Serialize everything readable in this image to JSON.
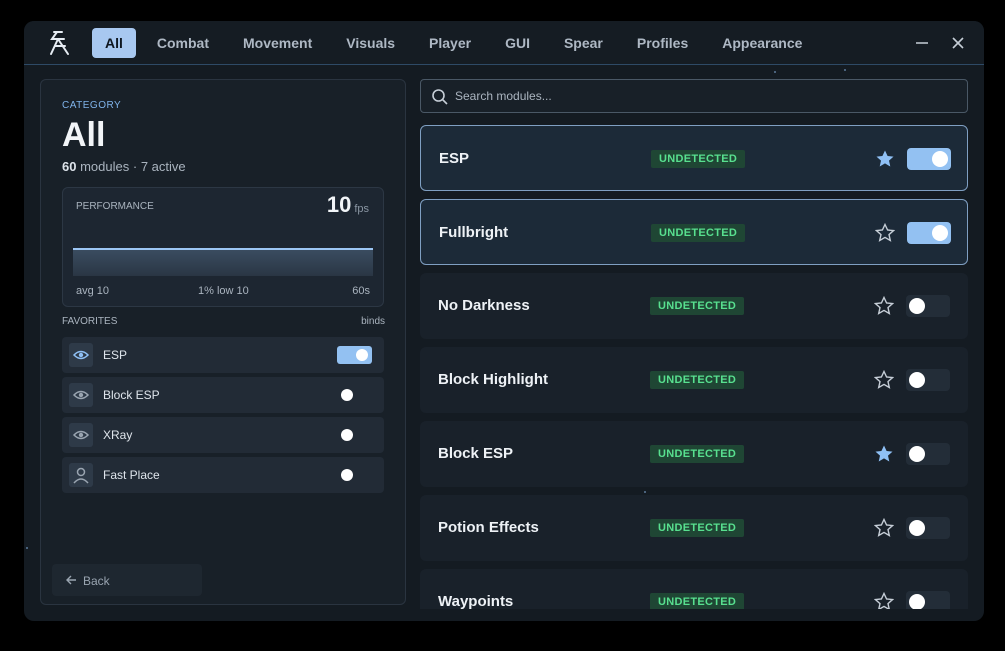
{
  "tabs": [
    {
      "label": "All",
      "active": true
    },
    {
      "label": "Combat"
    },
    {
      "label": "Movement"
    },
    {
      "label": "Visuals"
    },
    {
      "label": "Player"
    },
    {
      "label": "GUI"
    },
    {
      "label": "Spear"
    },
    {
      "label": "Profiles"
    },
    {
      "label": "Appearance"
    }
  ],
  "category": {
    "label": "CATEGORY",
    "title": "All",
    "module_count": "60",
    "modules_word": "modules",
    "active_count": "7",
    "active_word": "active"
  },
  "performance": {
    "label": "PERFORMANCE",
    "fps": "10",
    "fps_unit": "fps",
    "avg": "avg 10",
    "low": "1% low 10",
    "window": "60s"
  },
  "favorites": {
    "label": "FAVORITES",
    "binds_label": "binds",
    "items": [
      {
        "name": "ESP",
        "icon": "eye-icon",
        "enabled": true
      },
      {
        "name": "Block ESP",
        "icon": "eye-icon",
        "enabled": false
      },
      {
        "name": "XRay",
        "icon": "eye-icon",
        "enabled": false
      },
      {
        "name": "Fast Place",
        "icon": "user-icon",
        "enabled": false
      }
    ]
  },
  "back_label": "Back",
  "search": {
    "placeholder": "Search modules..."
  },
  "modules": [
    {
      "name": "ESP",
      "status": "UNDETECTED",
      "favorite": true,
      "enabled": true
    },
    {
      "name": "Fullbright",
      "status": "UNDETECTED",
      "favorite": false,
      "enabled": true
    },
    {
      "name": "No Darkness",
      "status": "UNDETECTED",
      "favorite": false,
      "enabled": false
    },
    {
      "name": "Block Highlight",
      "status": "UNDETECTED",
      "favorite": false,
      "enabled": false
    },
    {
      "name": "Block ESP",
      "status": "UNDETECTED",
      "favorite": true,
      "enabled": false
    },
    {
      "name": "Potion Effects",
      "status": "UNDETECTED",
      "favorite": false,
      "enabled": false
    },
    {
      "name": "Waypoints",
      "status": "UNDETECTED",
      "favorite": false,
      "enabled": false
    }
  ],
  "colors": {
    "accent": "#93c1f2",
    "badge_text": "#58e08f",
    "badge_bg": "#1f4634",
    "star_filled": "#8fc0f5"
  }
}
